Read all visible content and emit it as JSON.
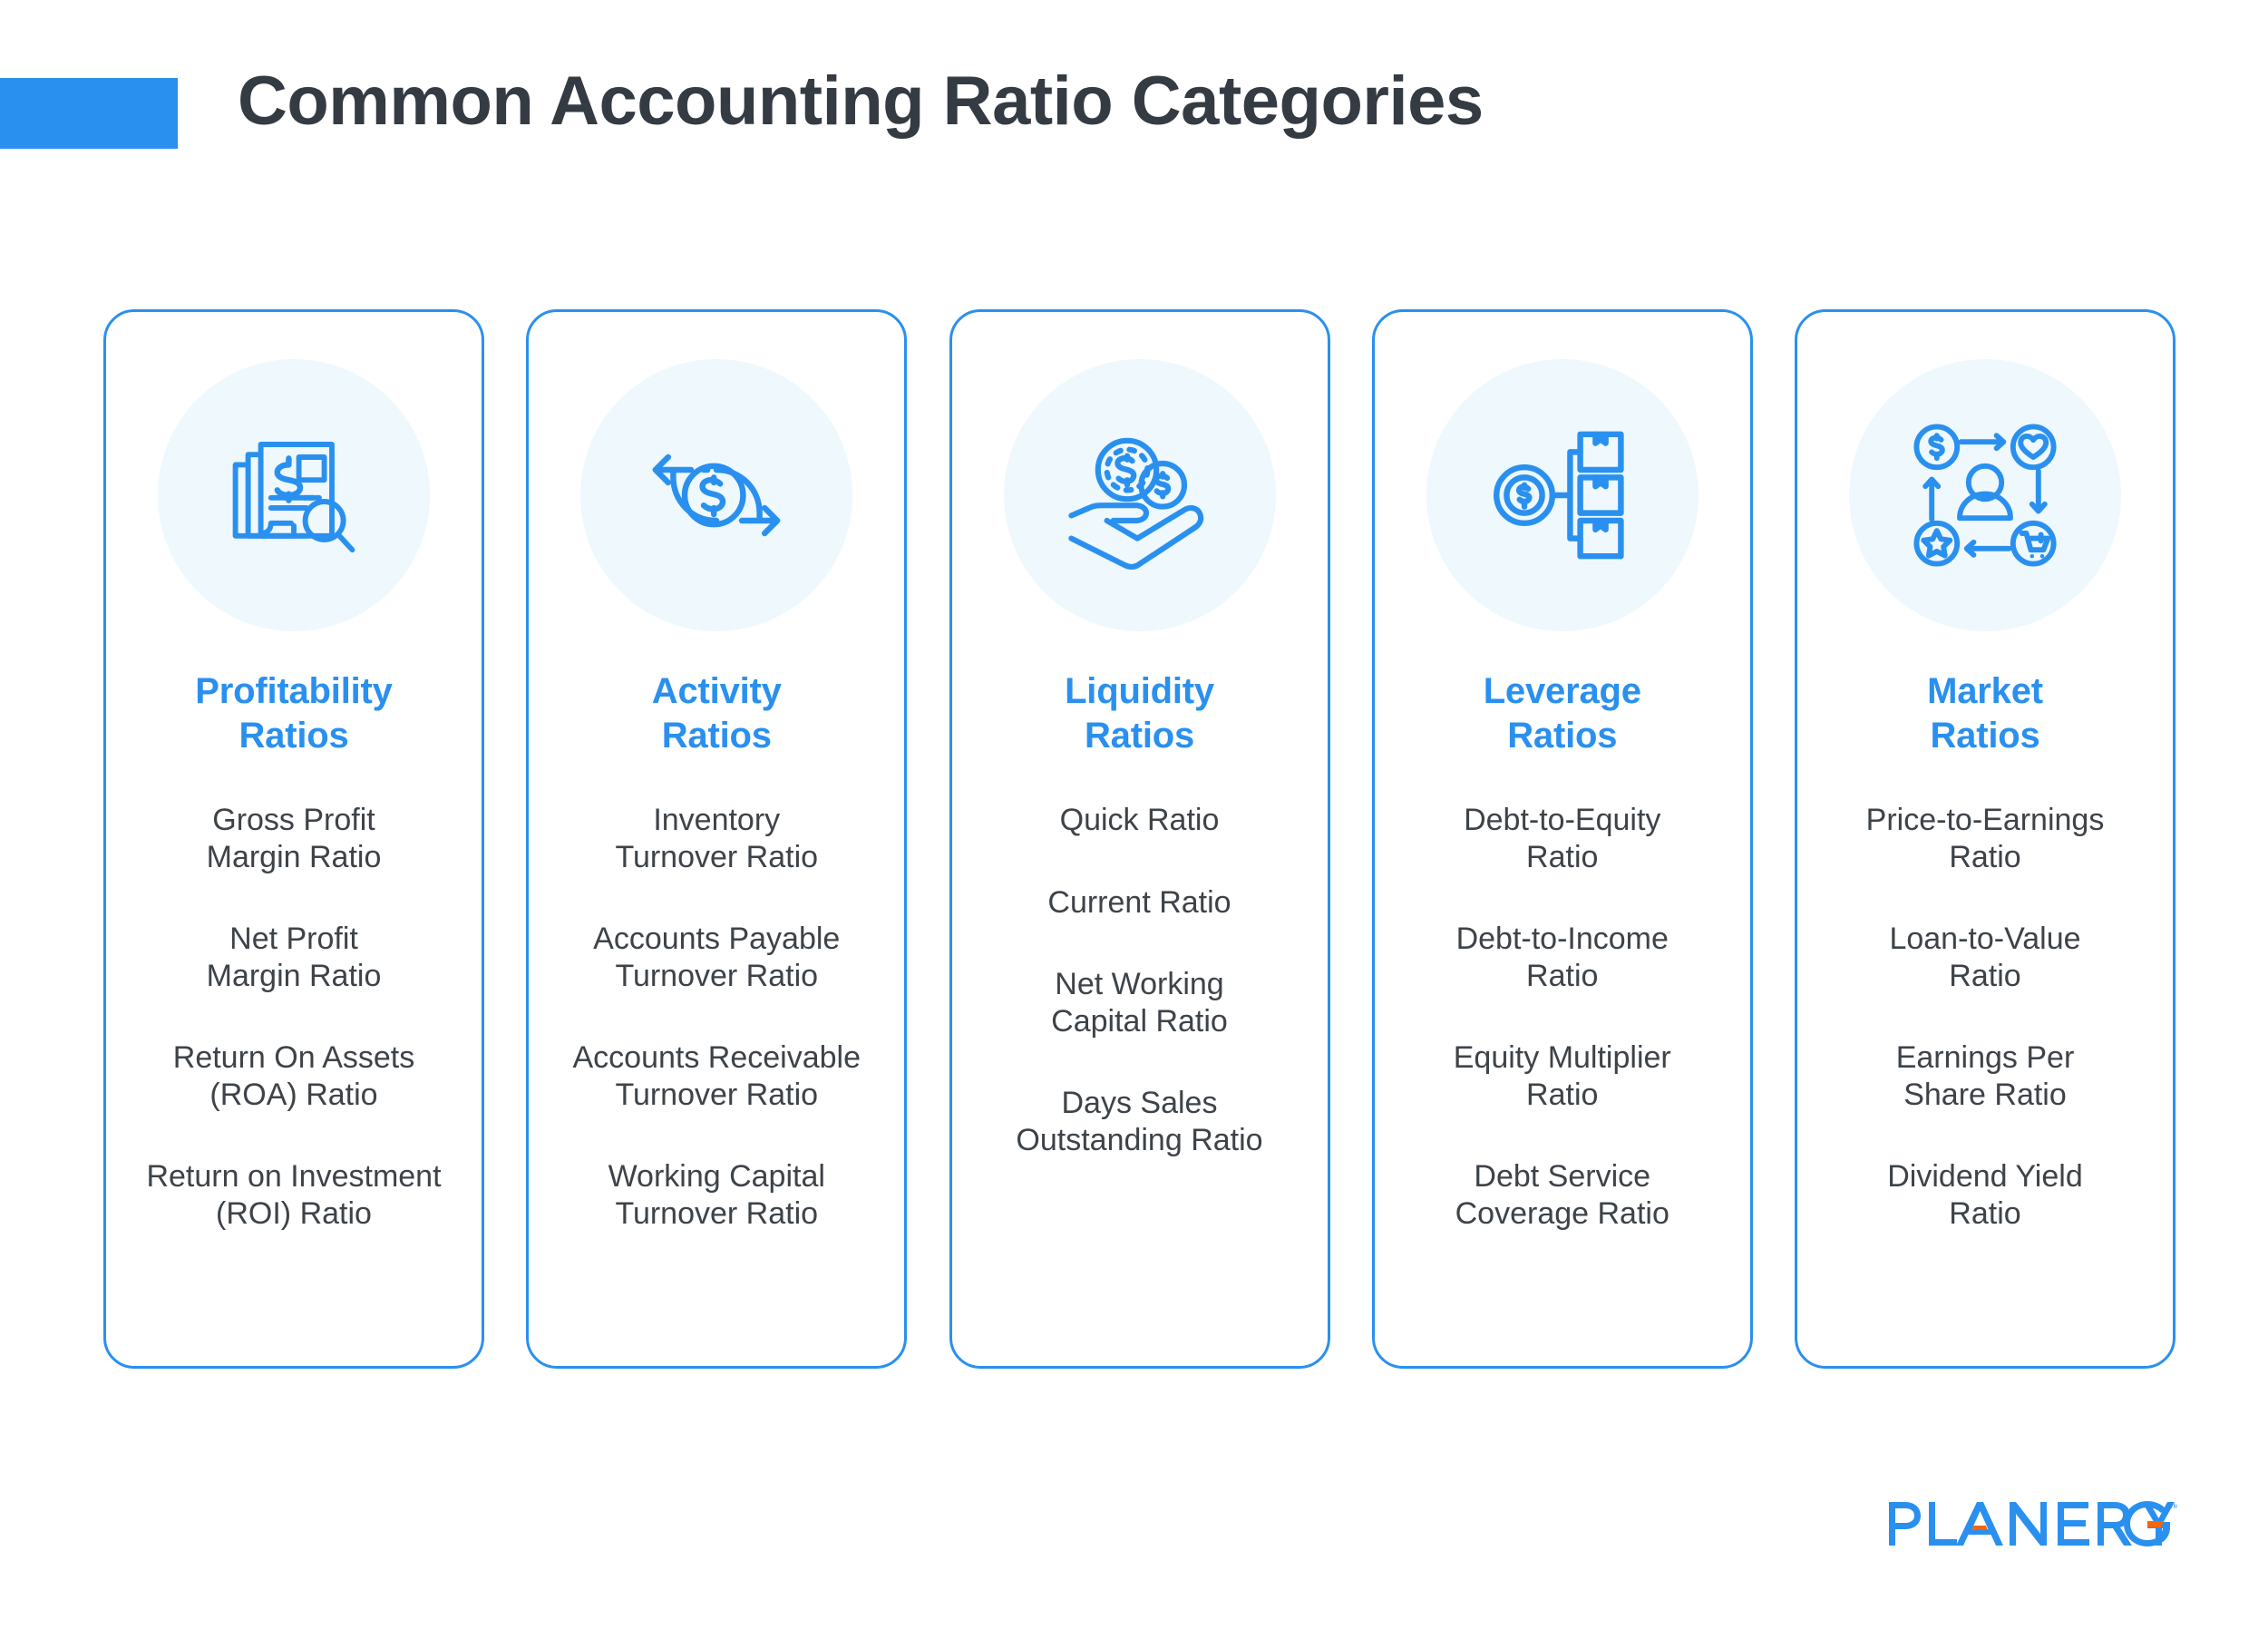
{
  "header": {
    "title": "Common Accounting Ratio Categories",
    "accent_color": "#2a90ef"
  },
  "colors": {
    "accent": "#2a90ef",
    "card_border": "#2a90ef",
    "icon_disc_bg": "#eef8fd",
    "title_text": "#353b43",
    "body_text": "#3d4349",
    "logo_blue": "#2a90ef",
    "logo_orange": "#f4650c",
    "background": "#ffffff"
  },
  "cards": [
    {
      "icon": "document-dollar-magnifier-icon",
      "title": "Profitability\nRatios",
      "items": [
        "Gross Profit\nMargin Ratio",
        "Net Profit\nMargin Ratio",
        "Return On Assets\n(ROA) Ratio",
        "Return on Investment\n(ROI) Ratio"
      ]
    },
    {
      "icon": "dollar-cycle-arrows-icon",
      "title": "Activity\nRatios",
      "items": [
        "Inventory\nTurnover Ratio",
        "Accounts Payable\nTurnover Ratio",
        "Accounts Receivable\nTurnover Ratio",
        "Working Capital\nTurnover Ratio"
      ]
    },
    {
      "icon": "hand-holding-coins-icon",
      "title": "Liquidity\nRatios",
      "items": [
        "Quick Ratio",
        "Current Ratio",
        "Net Working\nCapital Ratio",
        "Days Sales\nOutstanding Ratio"
      ]
    },
    {
      "icon": "dollar-boxes-hierarchy-icon",
      "title": "Leverage\nRatios",
      "items": [
        "Debt-to-Equity\nRatio",
        "Debt-to-Income\nRatio",
        "Equity Multiplier\nRatio",
        "Debt Service\nCoverage Ratio"
      ]
    },
    {
      "icon": "customer-market-cycle-icon",
      "title": "Market\nRatios",
      "items": [
        "Price-to-Earnings\nRatio",
        "Loan-to-Value\nRatio",
        "Earnings Per\nShare Ratio",
        "Dividend Yield\nRatio"
      ]
    }
  ],
  "footer": {
    "logo_text": "PLANERGY",
    "logo_trademark": "TM"
  }
}
